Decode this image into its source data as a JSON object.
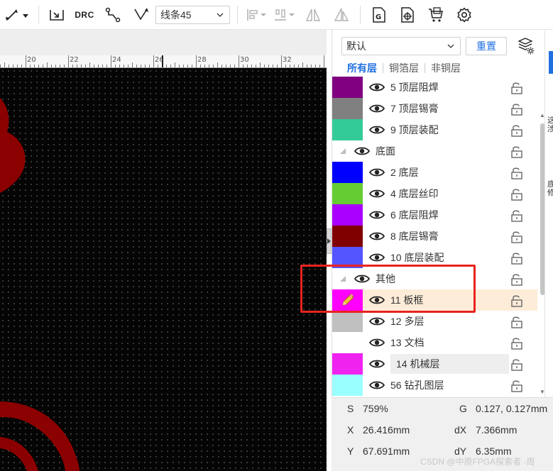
{
  "toolbar": {
    "drc_label": "DRC",
    "line_mode": "线条45"
  },
  "ruler": {
    "labels": [
      "20",
      "22",
      "24",
      "26",
      "28",
      "30",
      "32"
    ]
  },
  "layers_panel": {
    "preset": "默认",
    "reset_label": "重置",
    "tabs": [
      "所有层",
      "铜箔层",
      "非铜层"
    ],
    "rows": [
      {
        "kind": "layer",
        "name": "5 顶层阻焊",
        "color": "#800080"
      },
      {
        "kind": "layer",
        "name": "7 顶层锡膏",
        "color": "#808080"
      },
      {
        "kind": "layer",
        "name": "9 顶层装配",
        "color": "#33CC99"
      },
      {
        "kind": "group",
        "name": "底面"
      },
      {
        "kind": "layer",
        "name": "2 底层",
        "color": "#0000FF"
      },
      {
        "kind": "layer",
        "name": "4 底层丝印",
        "color": "#66CC33"
      },
      {
        "kind": "layer",
        "name": "6 底层阻焊",
        "color": "#AA00FF"
      },
      {
        "kind": "layer",
        "name": "8 底层锡膏",
        "color": "#800000"
      },
      {
        "kind": "layer",
        "name": "10 底层装配",
        "color": "#5555FF"
      },
      {
        "kind": "group",
        "name": "其他"
      },
      {
        "kind": "layer",
        "name": "11 板框",
        "color": "#FF00FF",
        "active": true,
        "icon": "pencil-icon"
      },
      {
        "kind": "layer",
        "name": "12 多层",
        "color": "#C0C0C0"
      },
      {
        "kind": "layer",
        "name": "13 文档",
        "color": "#FFFFFF"
      },
      {
        "kind": "layer",
        "name": "14 机械层",
        "color": "#F022F0",
        "highlight": true
      },
      {
        "kind": "layer",
        "name": "56 钻孔图层",
        "color": "#99FFFF"
      }
    ]
  },
  "side_strip": {
    "text_a": "这 涉",
    "text_b": "底 修"
  },
  "status": {
    "s_label": "S",
    "s_value": "759%",
    "g_label": "G",
    "g_value": "0.127, 0.127mm",
    "x_label": "X",
    "x_value": "26.416mm",
    "dx_label": "dX",
    "dx_value": "7.366mm",
    "y_label": "Y",
    "y_value": "67.691mm",
    "dy_label": "dY",
    "dy_value": "6.35mm"
  },
  "watermark": "CSDN @中原FPGA探索者 -周",
  "colors": {
    "accent": "#1F6FE0",
    "active_row": "#FDECD8",
    "annotation": "#E8231F",
    "canvas": "#050505",
    "copper_shape": "#8B0000"
  }
}
